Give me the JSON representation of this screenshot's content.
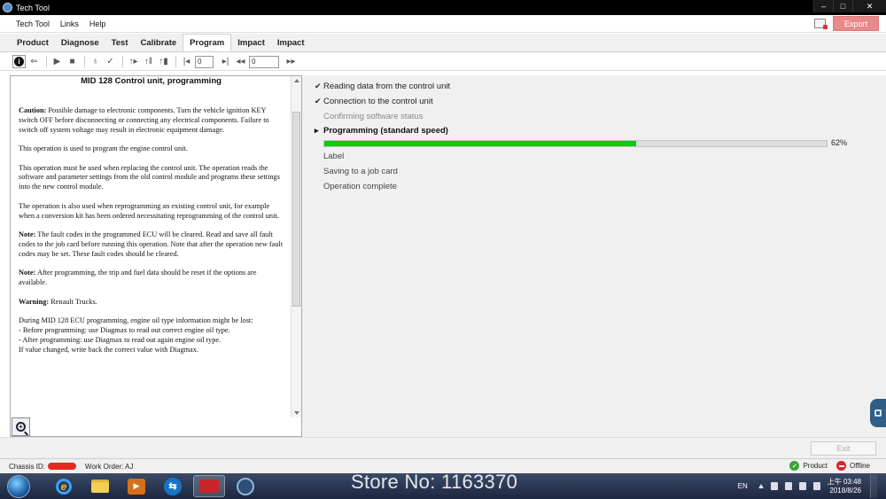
{
  "window": {
    "title": "Tech Tool",
    "minimize": "–",
    "maximize": "□",
    "close": "✕"
  },
  "menu": {
    "items": [
      "Tech Tool",
      "Links",
      "Help"
    ],
    "export_label": "Export"
  },
  "tabs": [
    {
      "label": "Product",
      "active": false
    },
    {
      "label": "Diagnose",
      "active": false
    },
    {
      "label": "Test",
      "active": false
    },
    {
      "label": "Calibrate",
      "active": false
    },
    {
      "label": "Program",
      "active": true
    },
    {
      "label": "Impact",
      "active": false
    },
    {
      "label": "Impact",
      "active": false
    }
  ],
  "toolbar": {
    "input1_value": "0",
    "input2_value": "0"
  },
  "doc": {
    "title": "MID 128 Control unit, programming",
    "caution_label": "Caution:",
    "caution_text": " Possible damage to electronic components. Turn the vehicle ignition KEY switch OFF before disconnecting or connecting any electrical components. Failure to switch off system voltage may result in electronic equipment damage.",
    "p1": "This operation is used to program the engine control unit.",
    "p2": "This operation must be used when replacing the control unit. The operation reads the software and parameter settings from the old control module and programs these settings into the new control module.",
    "p3": "The operation is also used when reprogramming an existing control unit, for example when a conversion kit has been ordered necessitating reprogramming of the control unit.",
    "note1_label": "Note:",
    "note1_text": " The fault codes in the programmed ECU will be cleared. Read and save all fault codes to the job card before running this operation. Note that after the operation new fault codes may be set. These fault codes should be cleared.",
    "note2_label": "Note:",
    "note2_text": " After programming, the trip and fuel data should be reset if the options are available.",
    "warning_label": "Warning:",
    "warning_text": " Renault Trucks.",
    "p4_line1": "During MID 128 ECU programming, engine oil type information might be lost:",
    "p4_line2": "- Before programming: use Diagmax to read out correct engine oil type.",
    "p4_line3": "- After programming: use Diagmax to read out again engine oil type.",
    "p4_line4": "If value changed, write back the correct value with Diagmax."
  },
  "steps": [
    {
      "label": "Reading data from the control unit",
      "mark": "✔",
      "state": "done"
    },
    {
      "label": "Connection to the control unit",
      "mark": "✔",
      "state": "done"
    },
    {
      "label": "Confirming software status",
      "mark": "",
      "state": "dim"
    },
    {
      "label": "Programming  (standard speed)",
      "mark": "▸",
      "state": "current"
    },
    {
      "label": "Label",
      "mark": "",
      "state": "pending"
    },
    {
      "label": "Saving to a job card",
      "mark": "",
      "state": "pending"
    },
    {
      "label": "Operation complete",
      "mark": "",
      "state": "pending"
    }
  ],
  "progress": {
    "percent": 62,
    "label": "62%",
    "color": "#14c514"
  },
  "buttons": {
    "exit_label": "Exit"
  },
  "status": {
    "chassis_label": "Chassis ID:",
    "work_order": "Work Order: AJ",
    "product_label": "Product",
    "offline_label": "Offline"
  },
  "taskbar": {
    "watermark": "Store No: 1163370",
    "lang": "EN",
    "time": "上午 03:48",
    "date": "2018/8/26"
  }
}
